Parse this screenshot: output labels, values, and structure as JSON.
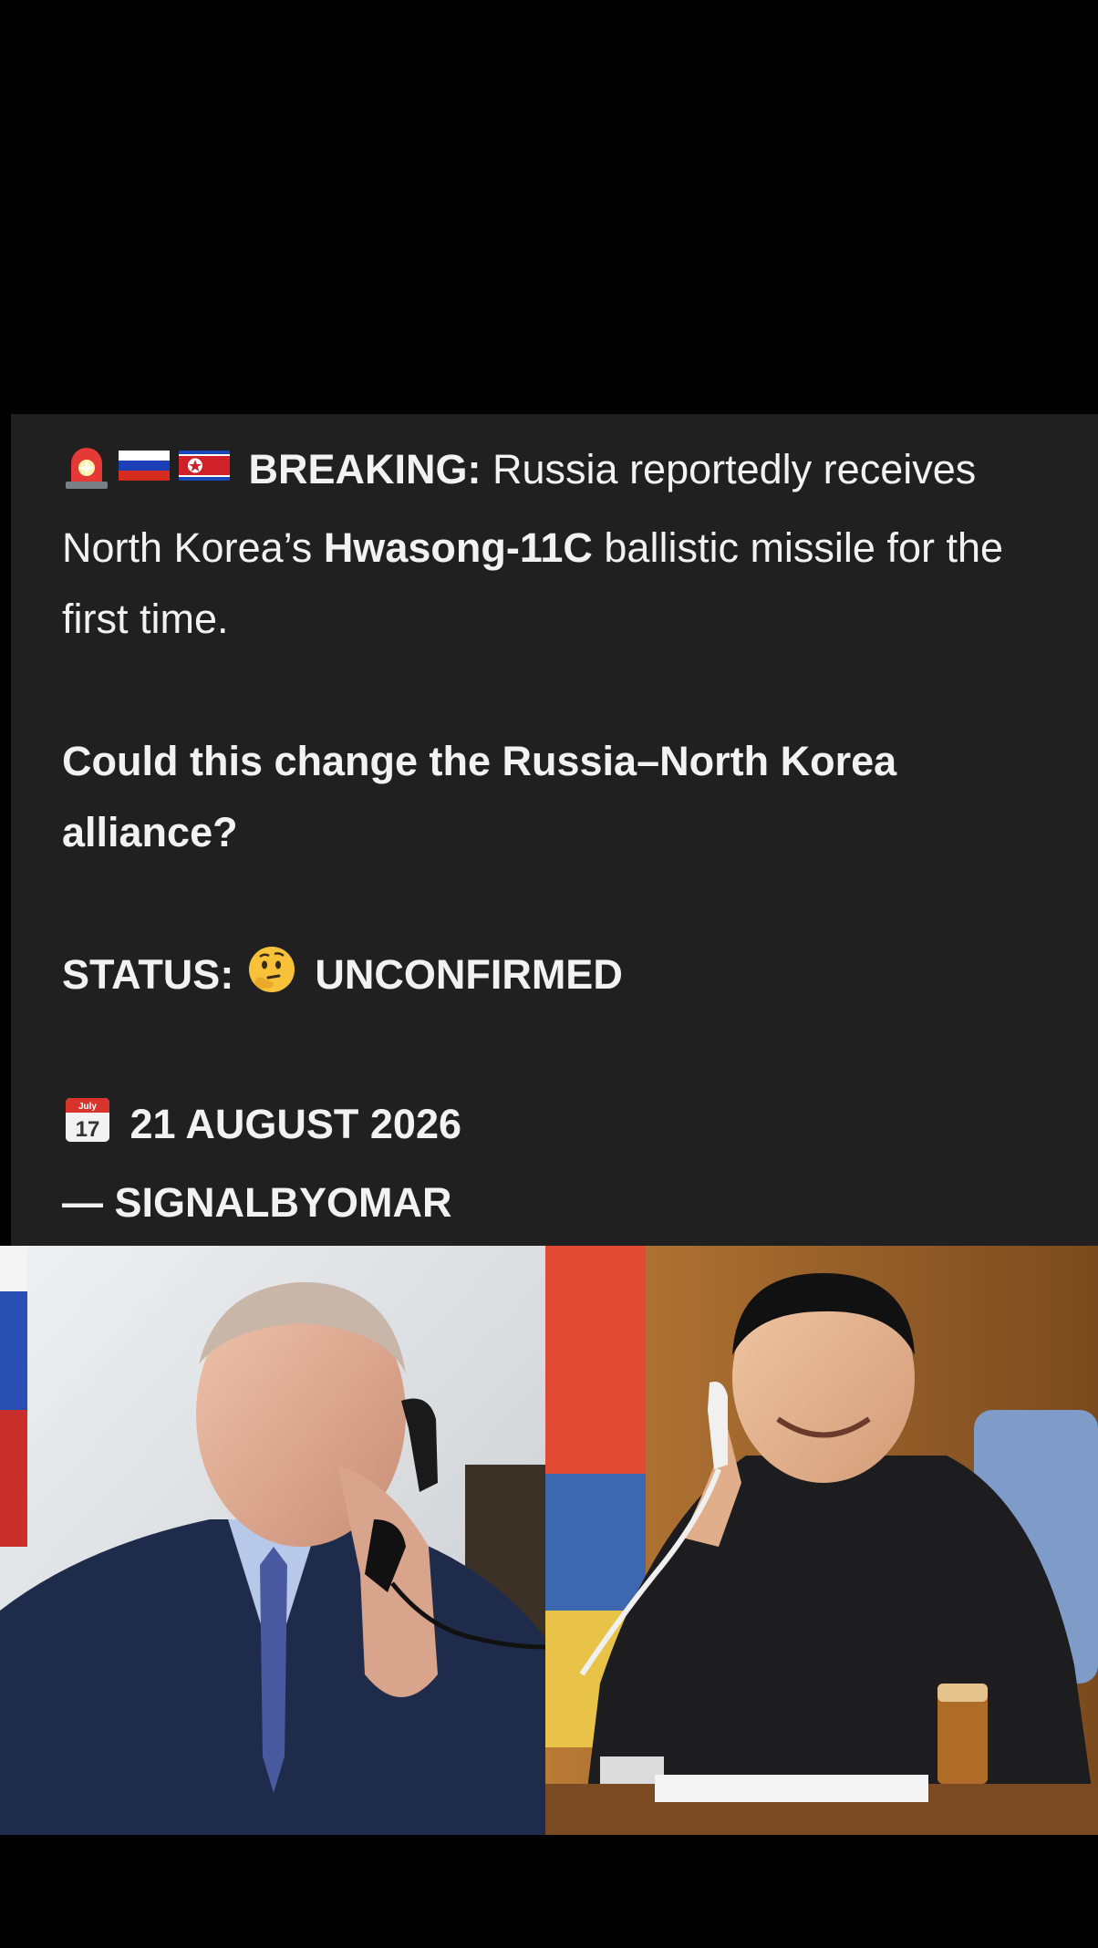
{
  "post": {
    "line1_emojis": [
      "siren-emoji",
      "russia-flag-emoji",
      "north-korea-flag-emoji"
    ],
    "breaking_label": "BREAKING:",
    "headline_part1": " Russia reportedly receives North Korea’s ",
    "missile_name": "Hwasong-11C",
    "headline_part2": " ballistic missile for the first time.",
    "question": "Could this change the Russia–North Korea alliance?",
    "status_label": "STATUS:",
    "status_value": "UNCONFIRMED",
    "status_emoji": "thinking-face-emoji",
    "calendar_month": "July",
    "calendar_day": "17",
    "date": "21 AUGUST 2026",
    "signature": "— SIGNALBYOMAR"
  },
  "photos": {
    "left": "putin-on-phone-photo",
    "right": "kim-on-phone-photo"
  },
  "colors": {
    "background": "#000000",
    "card": "#202020",
    "text": "#f2f2f2"
  }
}
